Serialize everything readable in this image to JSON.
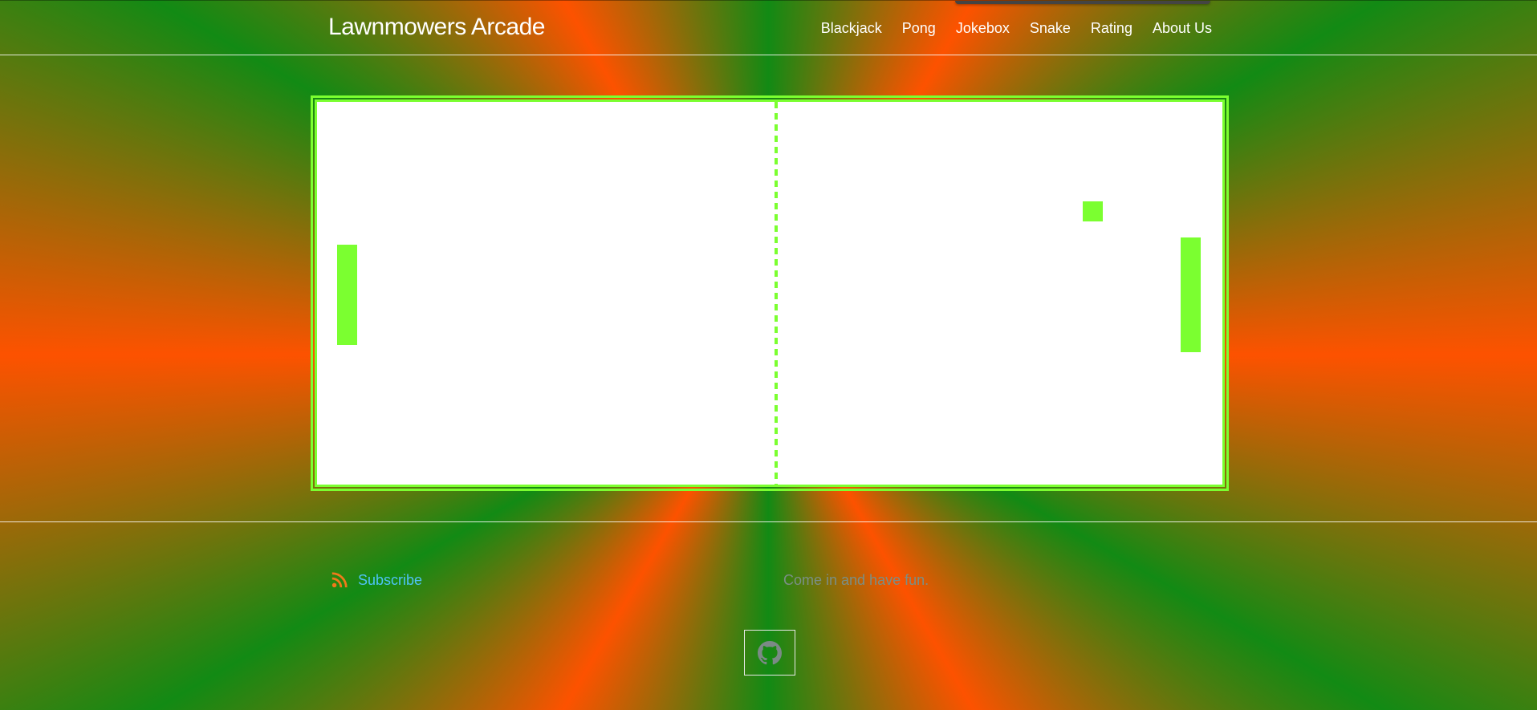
{
  "header": {
    "brand": "Lawnmowers Arcade",
    "nav": [
      "Blackjack",
      "Pong",
      "Jokebox",
      "Snake",
      "Rating",
      "About Us"
    ]
  },
  "game": {
    "court_color": "#ffffff",
    "accent_color": "#7bff30"
  },
  "footer": {
    "subscribe_label": "Subscribe",
    "tagline": "Come in and have fun.",
    "github_icon": "github-icon",
    "rss_icon": "rss-icon"
  },
  "colors": {
    "green": "#128a14",
    "orange": "#fd5200",
    "link": "#4fc3f7"
  }
}
